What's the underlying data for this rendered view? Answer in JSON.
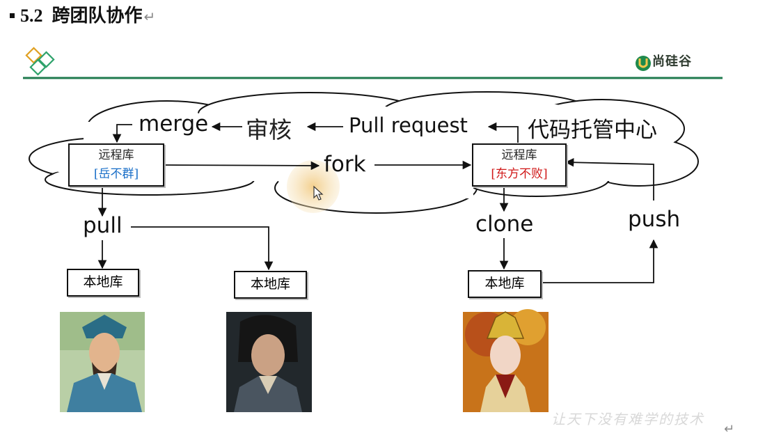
{
  "heading": {
    "number": "5.2",
    "title": "跨团队协作",
    "return_mark": "↵"
  },
  "brand": {
    "name": "尚硅谷",
    "color": "#1f8a4c"
  },
  "colors": {
    "rule": "#1f7a4e",
    "logo": "#2ea26b",
    "brand_blue": "#1a6fc8",
    "owner_red": "#d01818",
    "cursor_halo": "#f3d9a0"
  },
  "cloud": {
    "label": "代码托管中心"
  },
  "remotes": [
    {
      "label": "远程库",
      "owner": "[岳不群]",
      "owner_color": "#1a6fc8"
    },
    {
      "label": "远程库",
      "owner": "[东方不败]",
      "owner_color": "#d01818"
    }
  ],
  "actions": {
    "merge": "merge",
    "review": "审核",
    "pull_request": "Pull request",
    "fork": "fork",
    "pull": "pull",
    "clone": "clone",
    "push": "push"
  },
  "locals": [
    "本地库",
    "本地库",
    "本地库"
  ],
  "portraits": [
    {
      "icon": "scholar-portrait"
    },
    {
      "icon": "swordsman-portrait"
    },
    {
      "icon": "empress-portrait"
    }
  ],
  "watermark": "让天下没有难学的技术",
  "end_mark": "↵"
}
